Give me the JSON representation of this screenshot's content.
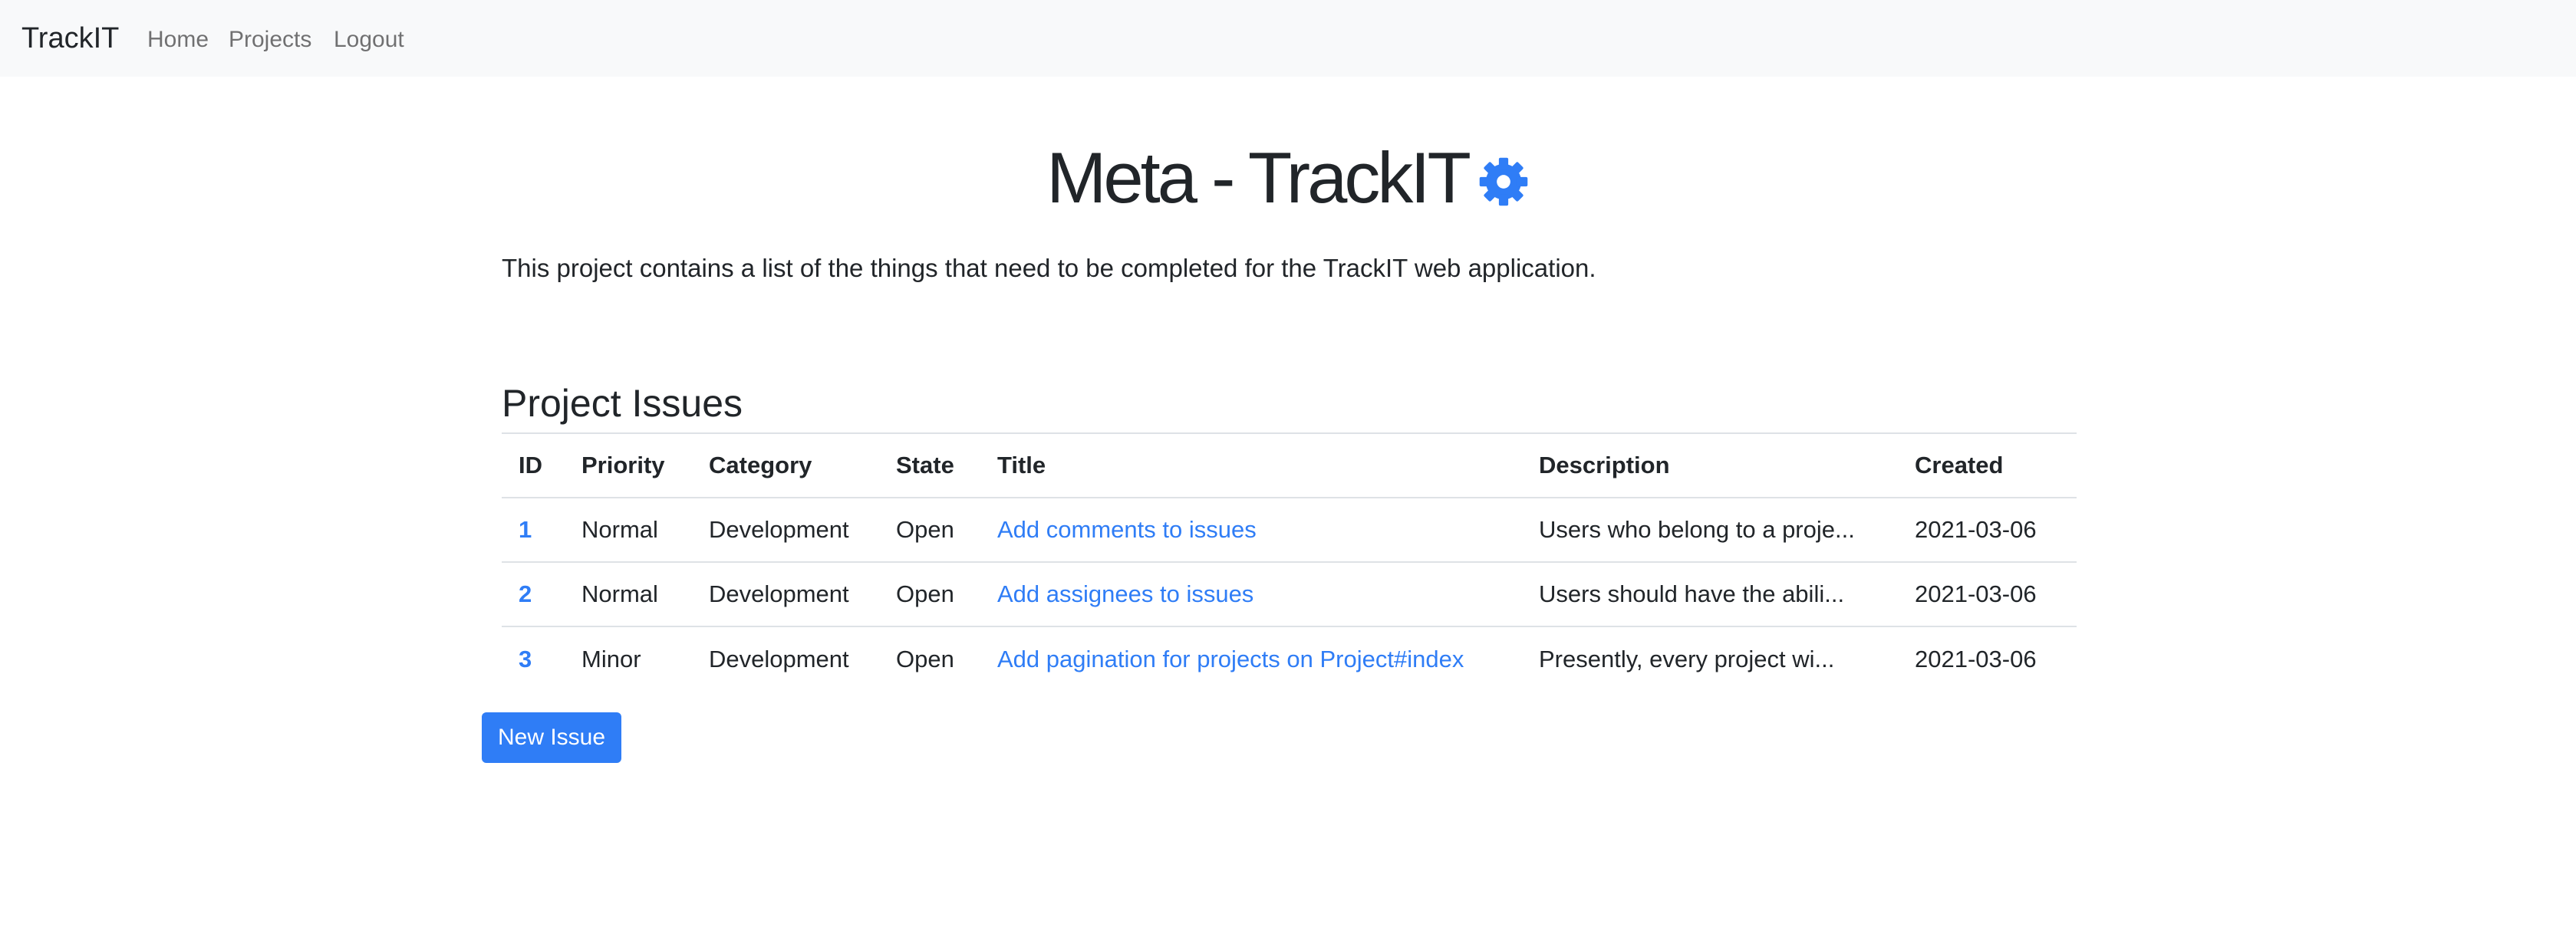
{
  "navbar": {
    "brand": "TrackIT",
    "links": [
      "Home",
      "Projects",
      "Logout"
    ]
  },
  "project": {
    "title": "Meta - TrackIT",
    "settings_icon": "gear-icon",
    "description": "This project contains a list of the things that need to be completed for the TrackIT web application."
  },
  "issues": {
    "heading": "Project Issues",
    "columns": [
      "ID",
      "Priority",
      "Category",
      "State",
      "Title",
      "Description",
      "Created"
    ],
    "rows": [
      {
        "id": "1",
        "priority": "Normal",
        "category": "Development",
        "state": "Open",
        "title": "Add comments to issues",
        "description": "Users who belong to a proje...",
        "created": "2021-03-06"
      },
      {
        "id": "2",
        "priority": "Normal",
        "category": "Development",
        "state": "Open",
        "title": "Add assignees to issues",
        "description": "Users should have the abili...",
        "created": "2021-03-06"
      },
      {
        "id": "3",
        "priority": "Minor",
        "category": "Development",
        "state": "Open",
        "title": "Add pagination for projects on Project#index",
        "description": "Presently, every project wi...",
        "created": "2021-03-06"
      }
    ],
    "new_button": "New Issue"
  },
  "colors": {
    "accent": "#2f7df6",
    "navbar_bg": "#f8f9fa",
    "text": "#212529"
  }
}
